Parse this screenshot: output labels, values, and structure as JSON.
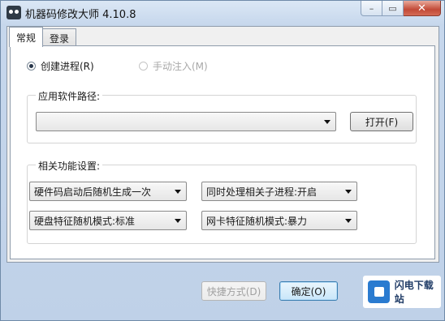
{
  "window": {
    "title": "机器码修改大师 4.10.8",
    "buttons": {
      "minimize": "–",
      "maximize": "▭",
      "close": "✕"
    }
  },
  "tabs": [
    {
      "label": "常规",
      "active": true
    },
    {
      "label": "登录",
      "active": false
    }
  ],
  "process_mode": {
    "create": {
      "label": "创建进程(R)",
      "selected": true
    },
    "inject": {
      "label": "手动注入(M)",
      "selected": false,
      "enabled": false
    }
  },
  "software_path": {
    "group_label": "应用软件路径:",
    "value": "",
    "open_button": "打开(F)"
  },
  "settings": {
    "group_label": "相关功能设置:",
    "hardware_code": "硬件码启动后随机生成一次",
    "child_process": "同时处理相关子进程:开启",
    "disk_mode": "硬盘特征随机模式:标准",
    "nic_mode": "网卡特征随机模式:暴力"
  },
  "footer": {
    "shortcut_button": "快捷方式(D)",
    "ok_button": "确定(O)"
  },
  "watermark": {
    "text": "闪电下载站"
  },
  "colors": {
    "close": "#c24a37",
    "accent": "#2a7bd0"
  }
}
